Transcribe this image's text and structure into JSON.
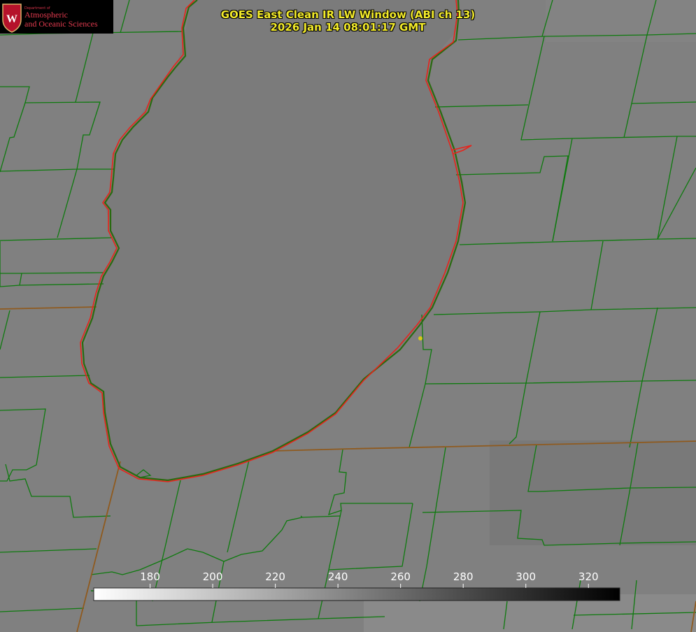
{
  "logo": {
    "dept": "Department of",
    "line1": "Atmospheric",
    "line2": "and Oceanic Sciences",
    "crest_letter": "W",
    "colors": {
      "crest": "#b5122b",
      "text": "#e03a4e",
      "background": "#000000"
    }
  },
  "title": {
    "line1": "GOES East Clean IR LW Window (ABI ch 13)",
    "line2": "2026 Jan 14 08:01:17 GMT",
    "color": "#f2ea2a"
  },
  "colorbar": {
    "ticks": [
      "180",
      "200",
      "220",
      "240",
      "260",
      "280",
      "300",
      "320"
    ],
    "tick_values": [
      180,
      200,
      220,
      240,
      260,
      280,
      300,
      320
    ],
    "range": [
      162,
      330
    ],
    "gradient": [
      "#ffffff",
      "#000000"
    ]
  },
  "map_colors": {
    "county_lines": "#0e7a0e",
    "shoreline": "#e8231a",
    "state_lines": "#a0501a",
    "marker": "#d8c81a",
    "background": "#808080"
  }
}
